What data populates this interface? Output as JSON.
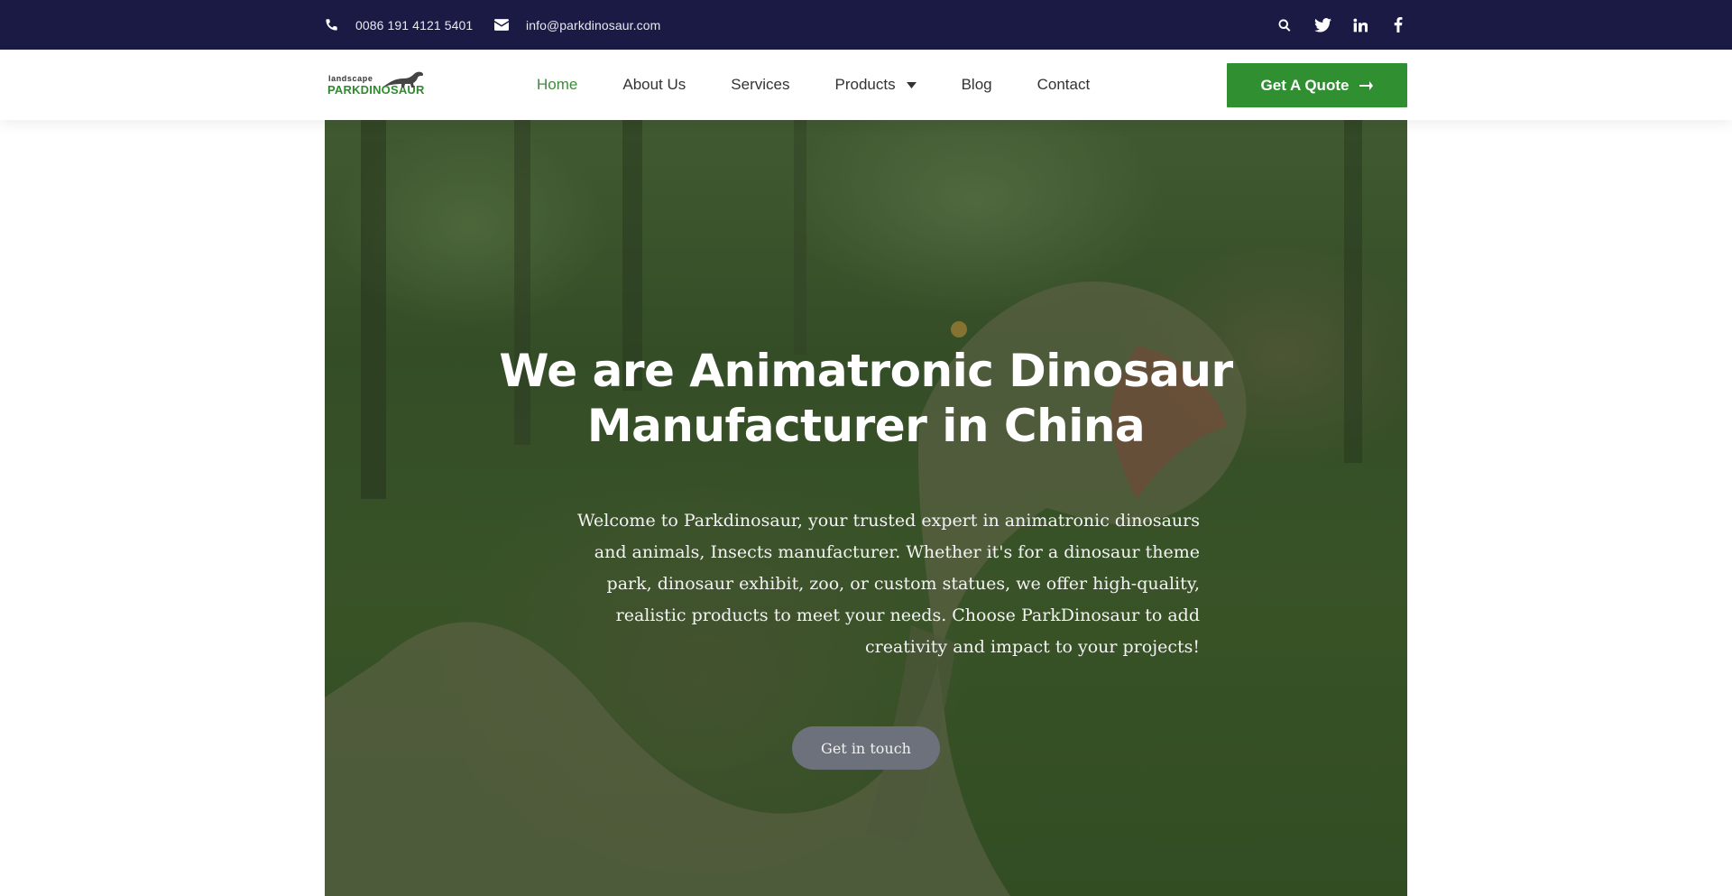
{
  "topbar": {
    "phone": "0086 191 4121 5401",
    "email": "info@parkdinosaur.com",
    "icons": [
      "search-icon",
      "twitter-icon",
      "linkedin-icon",
      "facebook-icon"
    ]
  },
  "header": {
    "logo": {
      "small_text": "landscape",
      "big_text": "PARKDINOSAUR"
    },
    "nav": [
      {
        "label": "Home",
        "active": true
      },
      {
        "label": "About Us"
      },
      {
        "label": "Services"
      },
      {
        "label": "Products",
        "has_dropdown": true
      },
      {
        "label": "Blog"
      },
      {
        "label": "Contact"
      }
    ],
    "quote_button": "Get A Quote"
  },
  "hero": {
    "title": "We are Animatronic Dinosaur Manufacturer in China",
    "description": "Welcome to Parkdinosaur, your trusted expert in animatronic dinosaurs and animals, Insects manufacturer. Whether it's for a dinosaur theme park, dinosaur exhibit, zoo, or custom statues, we offer high-quality, realistic products to meet your needs. Choose ParkDinosaur to add creativity and impact to your projects!",
    "cta": "Get in touch"
  },
  "colors": {
    "topbar_bg": "#1b1a44",
    "brand_green": "#2f8f31",
    "nav_active": "#3e8c3a",
    "cta_bg": "#6c717b"
  }
}
